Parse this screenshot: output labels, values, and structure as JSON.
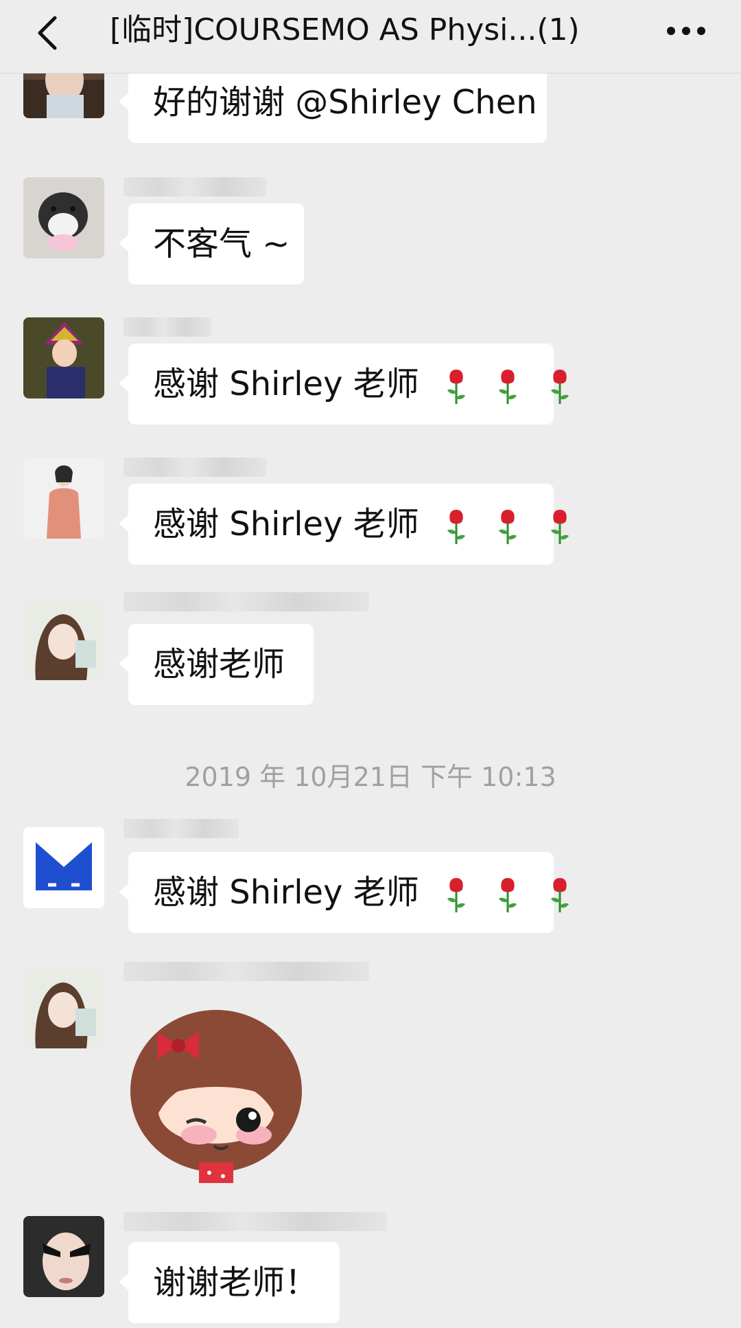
{
  "header": {
    "back_icon": "chevron-left-icon",
    "title": "[临时]COURSEMO AS Physi...(1)",
    "more_icon": "more-dots-icon"
  },
  "messages": [
    {
      "avatar": "avatar-girl-desk",
      "text": "好的谢谢 @Shirley Chen"
    },
    {
      "avatar": "avatar-dog",
      "text": "不客气 ~"
    },
    {
      "avatar": "avatar-anime-character",
      "text": "感谢 Shirley 老师",
      "emoji": "rose-icon"
    },
    {
      "avatar": "avatar-woman-suit",
      "text": "感谢 Shirley 老师",
      "emoji": "rose-icon"
    },
    {
      "avatar": "avatar-girl-illustration",
      "text": "感谢老师"
    },
    {
      "avatar": "avatar-blue-m-logo",
      "text": "感谢 Shirley 老师",
      "emoji": "rose-icon"
    },
    {
      "avatar": "avatar-girl-illustration",
      "sticker": "sticker-cartoon-girl-wink"
    },
    {
      "avatar": "avatar-girl-sunglasses",
      "text": "谢谢老师！"
    }
  ],
  "timestamp": "2019 年 10月21日  下午 10:13",
  "colors": {
    "background": "#ededed",
    "bubble": "#ffffff",
    "text": "#111111",
    "timestamp": "#a0a0a0"
  }
}
